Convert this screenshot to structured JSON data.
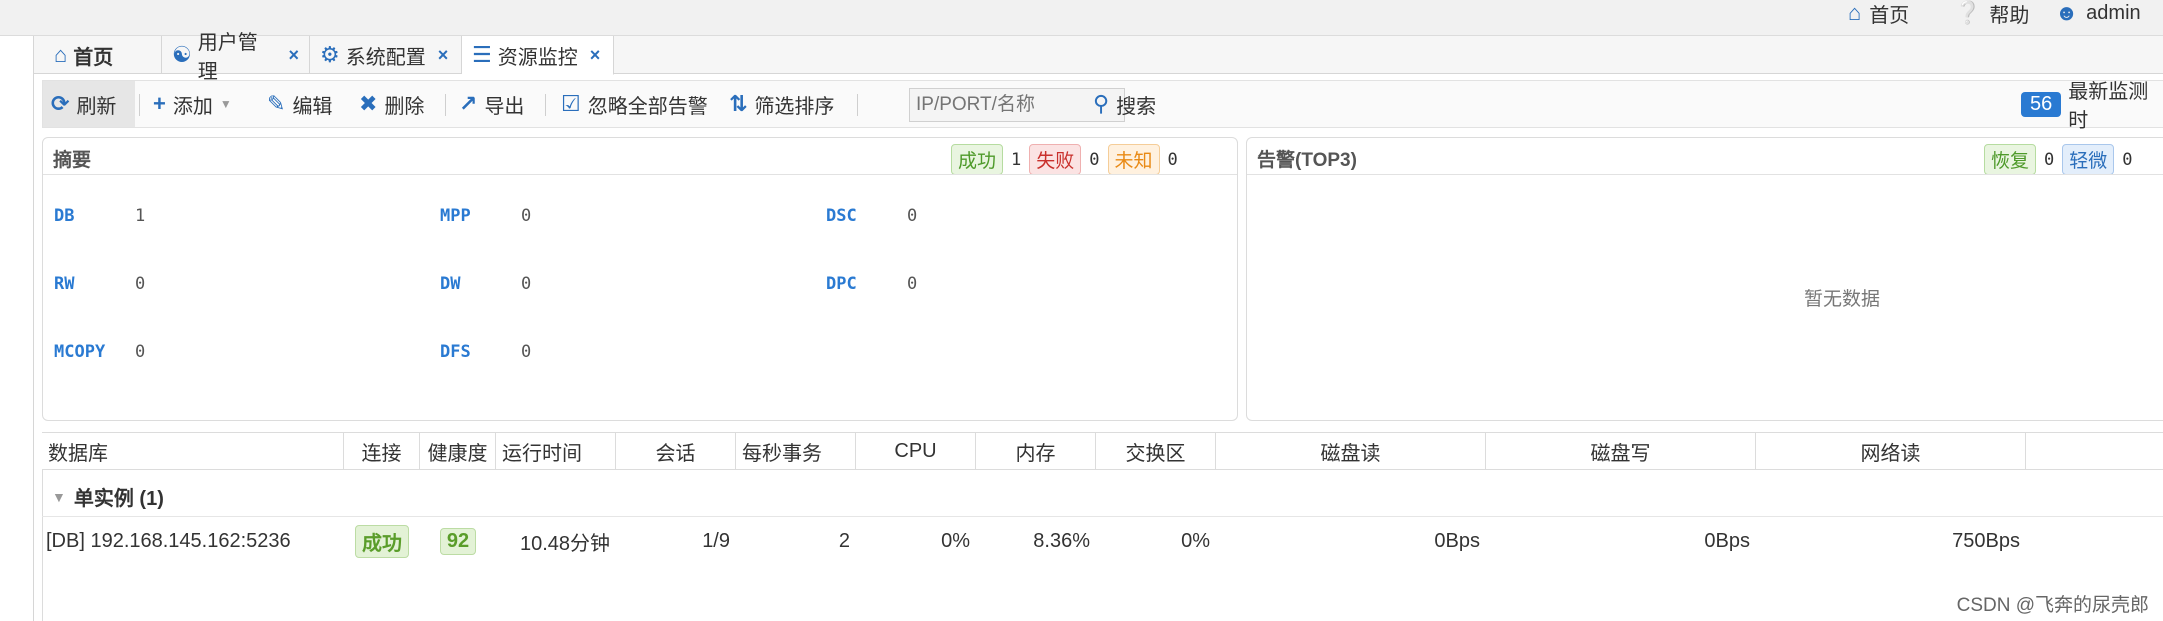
{
  "header": {
    "home": "首页",
    "help": "帮助",
    "user": "admin"
  },
  "tabs": [
    {
      "label": "首页",
      "icon": "home-icon",
      "closable": false
    },
    {
      "label": "用户管理",
      "icon": "users-icon",
      "closable": true
    },
    {
      "label": "系统配置",
      "icon": "gear-icon",
      "closable": true
    },
    {
      "label": "资源监控",
      "icon": "server-icon",
      "closable": true,
      "active": true
    }
  ],
  "toolbar": {
    "refresh": "刷新",
    "add": "添加",
    "edit": "编辑",
    "delete": "删除",
    "export": "导出",
    "ignore_all": "忽略全部告警",
    "filter_sort": "筛选排序",
    "search_placeholder": "IP/PORT/名称",
    "search": "搜索",
    "badge_count": "56",
    "latest_label": "最新监测时"
  },
  "summary": {
    "title": "摘要",
    "status": {
      "success_label": "成功",
      "success": "1",
      "fail_label": "失败",
      "fail": "0",
      "unknown_label": "未知",
      "unknown": "0"
    },
    "metrics": [
      {
        "key": "DB",
        "value": "1"
      },
      {
        "key": "MPP",
        "value": "0"
      },
      {
        "key": "DSC",
        "value": "0"
      },
      {
        "key": "RW",
        "value": "0"
      },
      {
        "key": "DW",
        "value": "0"
      },
      {
        "key": "DPC",
        "value": "0"
      },
      {
        "key": "MCOPY",
        "value": "0"
      },
      {
        "key": "DFS",
        "value": "0"
      }
    ]
  },
  "alerts": {
    "title": "告警(TOP3)",
    "recover_label": "恢复",
    "recover": "0",
    "minor_label": "轻微",
    "minor": "0",
    "empty": "暂无数据"
  },
  "table": {
    "columns": [
      "数据库",
      "连接",
      "健康度",
      "运行时间",
      "会话",
      "每秒事务",
      "CPU",
      "内存",
      "交换区",
      "磁盘读",
      "磁盘写",
      "网络读"
    ],
    "group": "单实例 (1)",
    "rows": [
      {
        "db": "[DB] 192.168.145.162:5236",
        "conn": "成功",
        "health": "92",
        "uptime": "10.48分钟",
        "sessions": "1/9",
        "tps": "2",
        "cpu": "0%",
        "mem": "8.36%",
        "swap": "0%",
        "disk_read": "0Bps",
        "disk_write": "0Bps",
        "net_read": "750Bps"
      }
    ]
  },
  "watermark": "CSDN @飞奔的尿壳郎",
  "colors": {
    "accent": "#2a7ad2",
    "success": "#5a9d2a",
    "fail": "#c9302c",
    "unknown": "#e98a15"
  }
}
